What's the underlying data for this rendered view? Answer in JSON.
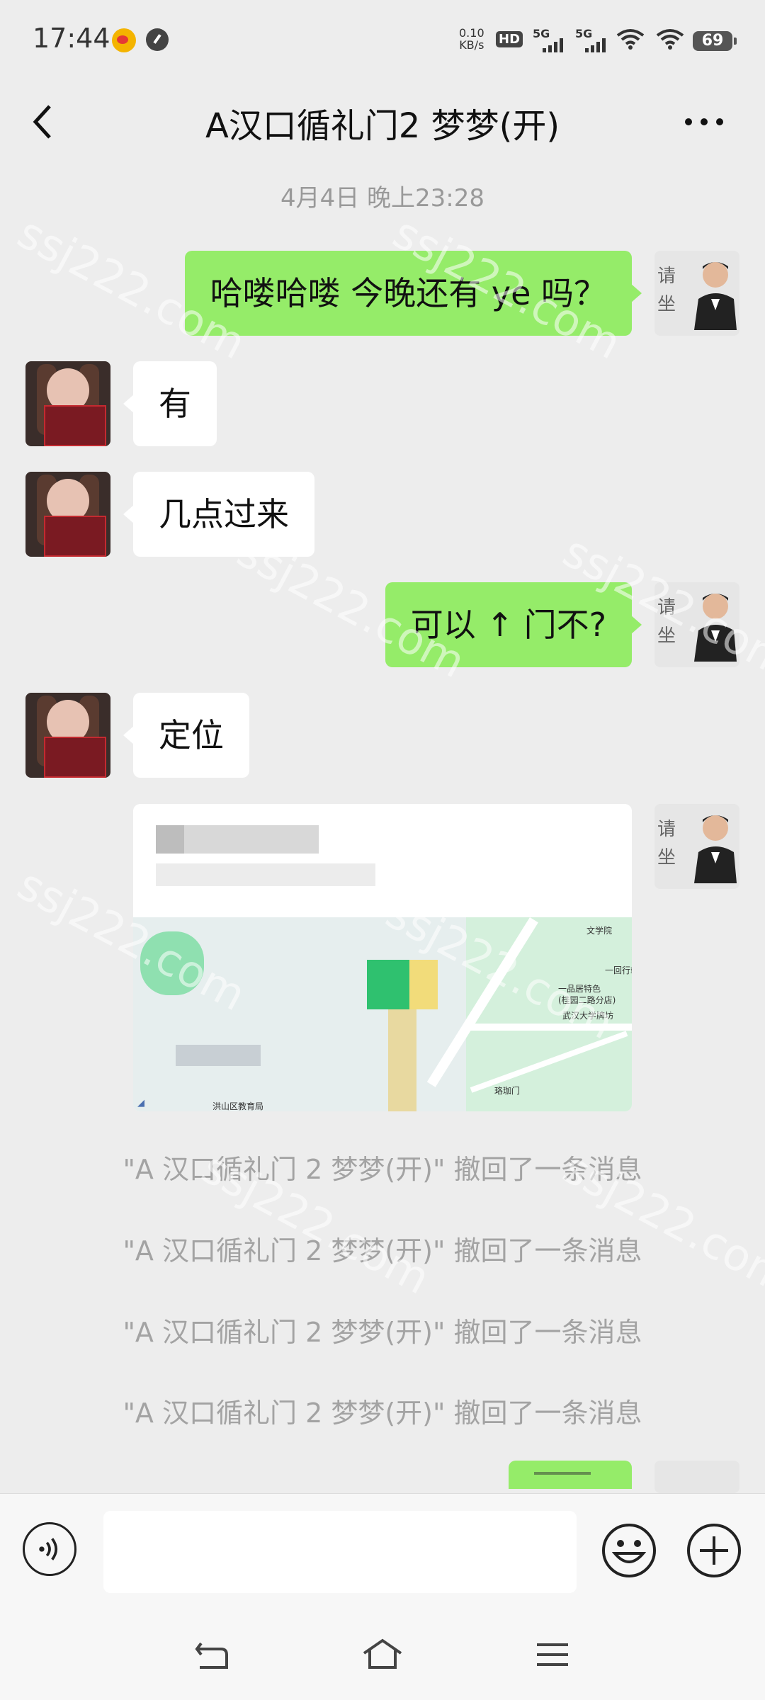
{
  "status_bar": {
    "time": "17:44",
    "net_speed_value": "0.10",
    "net_speed_unit": "KB/s",
    "hd_badge": "HD",
    "sim1_label": "5G",
    "sim2_label": "5G",
    "battery": "69"
  },
  "header": {
    "title": "A汉口循礼门2  梦梦(开)"
  },
  "timestamp": "4月4日 晚上23:28",
  "my_avatar_text": [
    "请",
    "坐"
  ],
  "messages": [
    {
      "from": "me",
      "text": "哈喽哈喽  今晚还有 ye 吗？"
    },
    {
      "from": "her",
      "text": "有"
    },
    {
      "from": "her",
      "text": "几点过来"
    },
    {
      "from": "me",
      "text": "可以 ↑ 门不?"
    },
    {
      "from": "her",
      "text": "定位"
    }
  ],
  "location_card": {
    "map_labels": [
      "文学院",
      "一回行站",
      "一品居特色",
      "(桂园二路分店)",
      "武汉大学牌坊",
      "洪山区教育局",
      "珞珈门"
    ]
  },
  "recall_notices": [
    "\"A 汉口循礼门 2  梦梦(开)\" 撤回了一条消息",
    "\"A 汉口循礼门 2  梦梦(开)\" 撤回了一条消息",
    "\"A 汉口循礼门 2  梦梦(开)\" 撤回了一条消息",
    "\"A 汉口循礼门 2  梦梦(开)\" 撤回了一条消息"
  ],
  "watermark": "ssj222.com",
  "input_bar": {
    "value": "",
    "icons": [
      "voice-icon",
      "emoji-icon",
      "plus-icon"
    ]
  },
  "system_nav": {
    "icons": [
      "back-nav-icon",
      "home-icon",
      "menu-icon"
    ]
  },
  "colors": {
    "background": "#ededed",
    "outgoing_bubble": "#95ec69",
    "incoming_bubble": "#ffffff",
    "notice_text": "#a3a3a3"
  }
}
